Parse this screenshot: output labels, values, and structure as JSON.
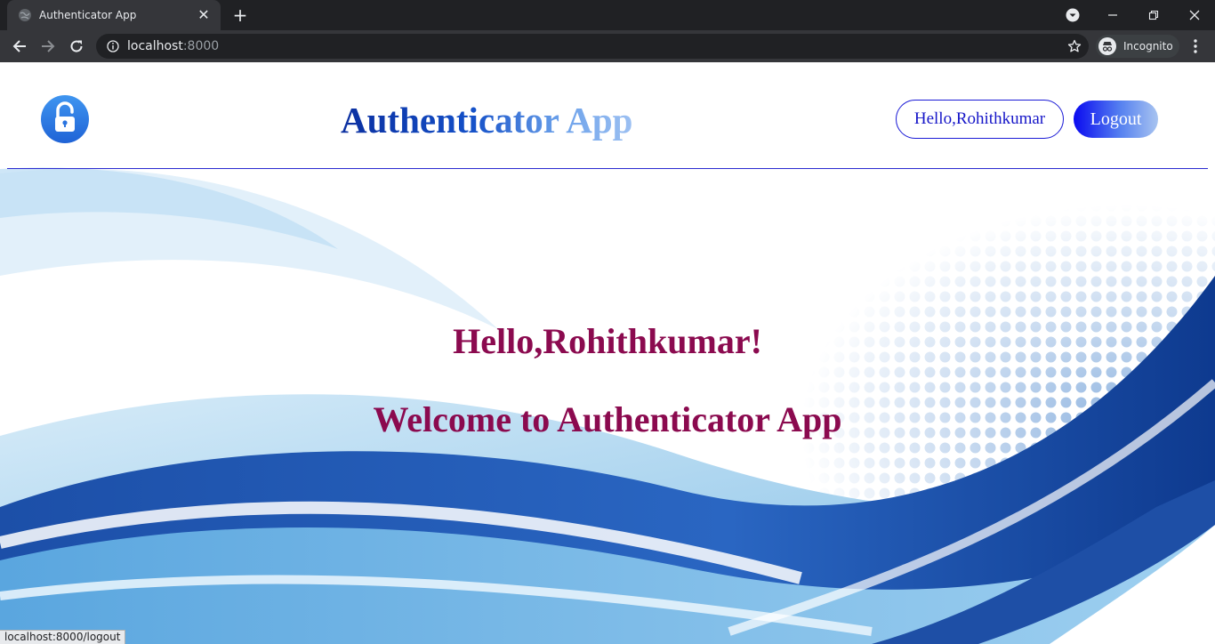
{
  "browser": {
    "tab_title": "Authenticator App",
    "url_host": "localhost",
    "url_port": ":8000",
    "profile_label": "Incognito",
    "status_url": "localhost:8000/logout"
  },
  "header": {
    "brand": "Authenticator App",
    "user_button": "Hello,Rohithkumar",
    "logout_button": "Logout"
  },
  "main": {
    "greeting": "Hello,Rohithkumar!",
    "welcome": "Welcome to Authenticator App"
  },
  "colors": {
    "brand_blue": "#1450c8",
    "accent_blue": "#1a1ad6",
    "heading_maroon": "#8b0a4f",
    "logo_blue": "#2f7fe8"
  },
  "icons": {
    "logo": "open-padlock-icon"
  }
}
